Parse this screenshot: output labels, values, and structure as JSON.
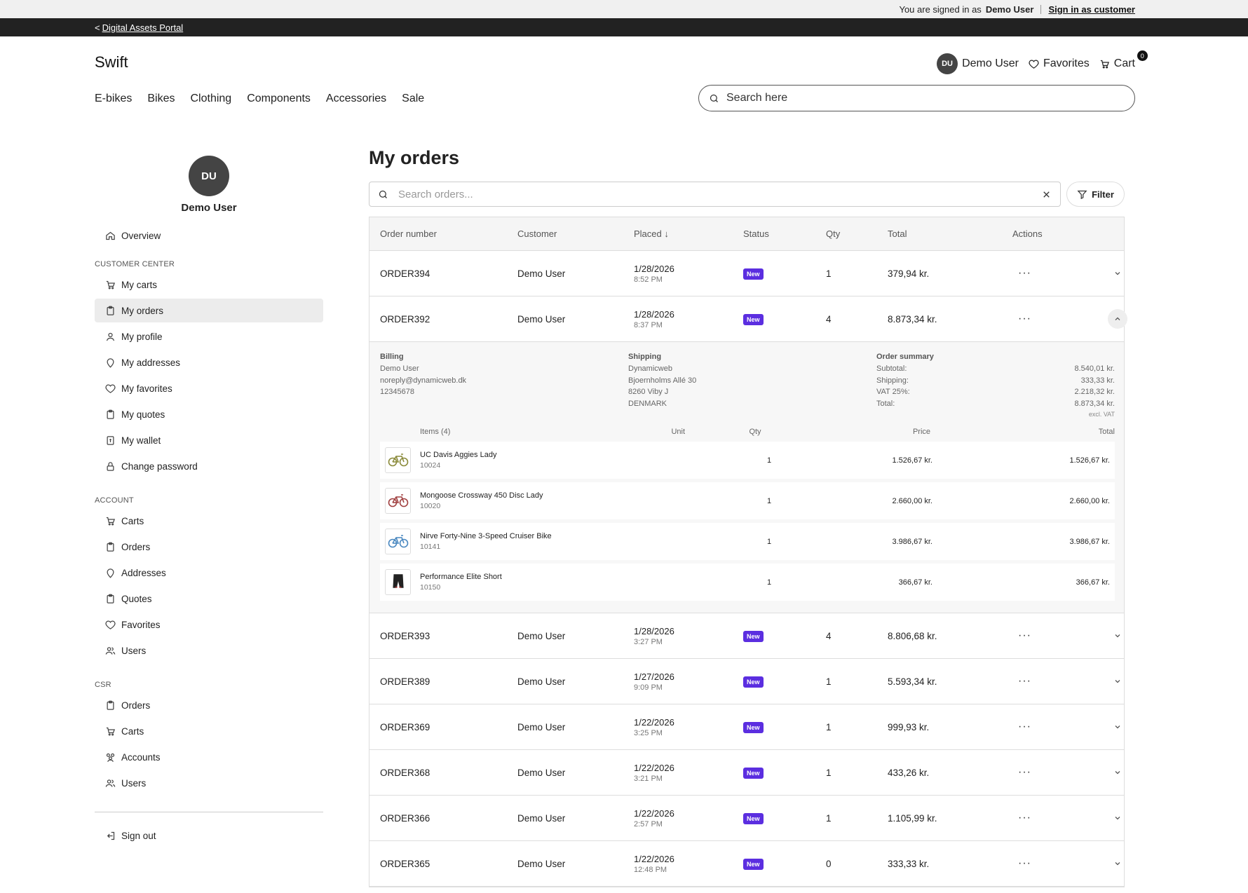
{
  "impersonation": {
    "prefix": "You are signed in as",
    "user": "Demo User",
    "link": "Sign in as customer"
  },
  "portal": {
    "prefix": "<",
    "link": "Digital Assets Portal"
  },
  "header": {
    "logo": "Swift",
    "user_initials": "DU",
    "user_name": "Demo User",
    "favorites": "Favorites",
    "cart": "Cart",
    "cart_count": "0",
    "nav": [
      "E-bikes",
      "Bikes",
      "Clothing",
      "Components",
      "Accessories",
      "Sale"
    ],
    "search_placeholder": "Search here"
  },
  "sidebar": {
    "initials": "DU",
    "name": "Demo User",
    "overview": "Overview",
    "customer_center_heading": "CUSTOMER CENTER",
    "customer_center": [
      {
        "label": "My carts",
        "icon": "cart-icon"
      },
      {
        "label": "My orders",
        "icon": "clipboard-icon",
        "active": true
      },
      {
        "label": "My profile",
        "icon": "user-icon"
      },
      {
        "label": "My addresses",
        "icon": "pin-icon"
      },
      {
        "label": "My favorites",
        "icon": "heart-icon"
      },
      {
        "label": "My quotes",
        "icon": "clipboard-icon"
      },
      {
        "label": "My wallet",
        "icon": "wallet-icon"
      },
      {
        "label": "Change password",
        "icon": "lock-icon"
      }
    ],
    "account_heading": "ACCOUNT",
    "account": [
      {
        "label": "Carts",
        "icon": "cart-icon"
      },
      {
        "label": "Orders",
        "icon": "clipboard-icon"
      },
      {
        "label": "Addresses",
        "icon": "pin-icon"
      },
      {
        "label": "Quotes",
        "icon": "clipboard-icon"
      },
      {
        "label": "Favorites",
        "icon": "heart-icon"
      },
      {
        "label": "Users",
        "icon": "users-icon"
      }
    ],
    "csr_heading": "CSR",
    "csr": [
      {
        "label": "Orders",
        "icon": "clipboard-icon"
      },
      {
        "label": "Carts",
        "icon": "cart-icon"
      },
      {
        "label": "Accounts",
        "icon": "accounts-icon"
      },
      {
        "label": "Users",
        "icon": "users-icon"
      }
    ],
    "sign_out": "Sign out"
  },
  "main": {
    "title": "My orders",
    "search_placeholder": "Search orders...",
    "filter_label": "Filter",
    "columns": {
      "order": "Order number",
      "customer": "Customer",
      "placed": "Placed",
      "status": "Status",
      "qty": "Qty",
      "total": "Total",
      "actions": "Actions"
    },
    "sort_arrow": "↓",
    "orders_before": [
      {
        "number": "ORDER394",
        "customer": "Demo User",
        "date": "1/28/2026",
        "time": "8:52 PM",
        "status": "New",
        "qty": "1",
        "total": "379,94 kr."
      },
      {
        "number": "ORDER392",
        "customer": "Demo User",
        "date": "1/28/2026",
        "time": "8:37 PM",
        "status": "New",
        "qty": "4",
        "total": "8.873,34 kr."
      }
    ],
    "expanded": {
      "billing_label": "Billing",
      "billing": [
        "Demo User",
        "noreply@dynamicweb.dk",
        "12345678"
      ],
      "shipping_label": "Shipping",
      "shipping": [
        "Dynamicweb",
        "Bjoernholms Allé 30",
        "8260 Viby J",
        "DENMARK"
      ],
      "summary_label": "Order summary",
      "summary": [
        {
          "label": "Subtotal:",
          "value": "8.540,01 kr."
        },
        {
          "label": "Shipping:",
          "value": "333,33 kr."
        },
        {
          "label": "VAT 25%:",
          "value": "2.218,32 kr."
        },
        {
          "label": "Total:",
          "value": "8.873,34 kr."
        }
      ],
      "excl_vat": "excl. VAT",
      "items_heading": "Items (4)",
      "unit_heading": "Unit",
      "qty_heading": "Qty",
      "price_heading": "Price",
      "total_heading": "Total",
      "items": [
        {
          "name": "UC Davis Aggies Lady",
          "sku": "10024",
          "qty": "1",
          "price": "1.526,67 kr.",
          "total": "1.526,67 kr.",
          "icon": "bike-icon",
          "color": "#8a8a3a"
        },
        {
          "name": "Mongoose Crossway 450 Disc Lady",
          "sku": "10020",
          "qty": "1",
          "price": "2.660,00 kr.",
          "total": "2.660,00 kr.",
          "icon": "bike-icon",
          "color": "#a04040"
        },
        {
          "name": "Nirve Forty-Nine 3-Speed Cruiser Bike",
          "sku": "10141",
          "qty": "1",
          "price": "3.986,67 kr.",
          "total": "3.986,67 kr.",
          "icon": "bike-icon",
          "color": "#4a88c0"
        },
        {
          "name": "Performance Elite Short",
          "sku": "10150",
          "qty": "1",
          "price": "366,67 kr.",
          "total": "366,67 kr.",
          "icon": "shorts-icon",
          "color": "#222222"
        }
      ]
    },
    "orders_after": [
      {
        "number": "ORDER393",
        "customer": "Demo User",
        "date": "1/28/2026",
        "time": "3:27 PM",
        "status": "New",
        "qty": "4",
        "total": "8.806,68 kr."
      },
      {
        "number": "ORDER389",
        "customer": "Demo User",
        "date": "1/27/2026",
        "time": "9:09 PM",
        "status": "New",
        "qty": "1",
        "total": "5.593,34 kr."
      },
      {
        "number": "ORDER369",
        "customer": "Demo User",
        "date": "1/22/2026",
        "time": "3:25 PM",
        "status": "New",
        "qty": "1",
        "total": "999,93 kr."
      },
      {
        "number": "ORDER368",
        "customer": "Demo User",
        "date": "1/22/2026",
        "time": "3:21 PM",
        "status": "New",
        "qty": "1",
        "total": "433,26 kr."
      },
      {
        "number": "ORDER366",
        "customer": "Demo User",
        "date": "1/22/2026",
        "time": "2:57 PM",
        "status": "New",
        "qty": "1",
        "total": "1.105,99 kr."
      },
      {
        "number": "ORDER365",
        "customer": "Demo User",
        "date": "1/22/2026",
        "time": "12:48 PM",
        "status": "New",
        "qty": "0",
        "total": "333,33 kr."
      }
    ],
    "badge_color": "#5b2ee0"
  }
}
